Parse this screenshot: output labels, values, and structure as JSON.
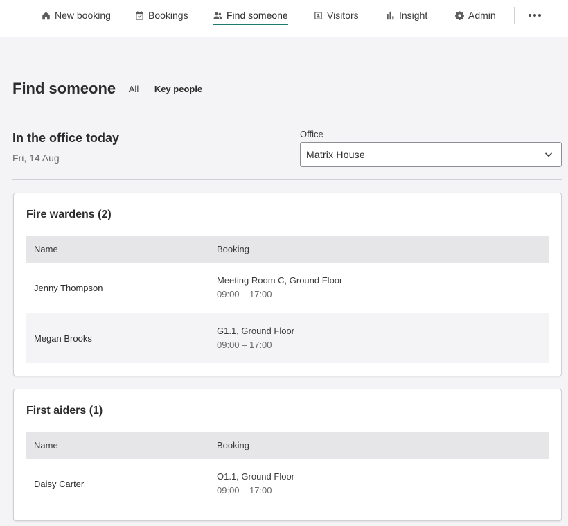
{
  "nav": {
    "items": [
      {
        "label": "New booking",
        "icon": "home-icon"
      },
      {
        "label": "Bookings",
        "icon": "calendar-check-icon"
      },
      {
        "label": "Find someone",
        "icon": "people-icon",
        "active": true
      },
      {
        "label": "Visitors",
        "icon": "visitor-badge-icon"
      },
      {
        "label": "Insight",
        "icon": "bar-chart-icon"
      },
      {
        "label": "Admin",
        "icon": "gear-icon"
      }
    ],
    "more_icon": "ellipsis-icon"
  },
  "page": {
    "title": "Find someone",
    "tabs": [
      {
        "label": "All",
        "active": false
      },
      {
        "label": "Key people",
        "active": true
      }
    ]
  },
  "office_today": {
    "title": "In the office today",
    "date": "Fri, 14 Aug",
    "office_label": "Office",
    "office_value": "Matrix House"
  },
  "groups": [
    {
      "title": "Fire wardens (2)",
      "columns": [
        "Name",
        "Booking"
      ],
      "rows": [
        {
          "name": "Jenny Thompson",
          "location": "Meeting Room C, Ground Floor",
          "time": "09:00 – 17:00"
        },
        {
          "name": "Megan Brooks",
          "location": "G1.1, Ground Floor",
          "time": "09:00 – 17:00"
        }
      ]
    },
    {
      "title": "First aiders (1)",
      "columns": [
        "Name",
        "Booking"
      ],
      "rows": [
        {
          "name": "Daisy Carter",
          "location": "O1.1, Ground Floor",
          "time": "09:00 – 17:00"
        }
      ]
    }
  ],
  "colors": {
    "accent": "#1d7a6e",
    "background": "#f4f4f6",
    "table_header": "#e6e6e9"
  }
}
